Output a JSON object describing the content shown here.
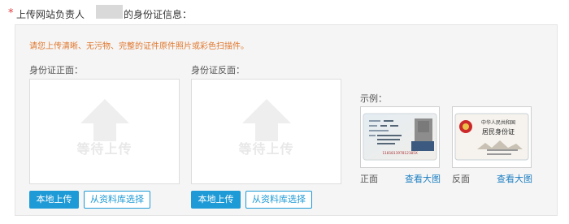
{
  "header": {
    "required_mark": "*",
    "label_prefix": "上传网站负责人",
    "label_suffix": "的身份证信息："
  },
  "notice": "请您上传清晰、无污物、完整的证件原件照片或彩色扫描件。",
  "upload_slots": [
    {
      "label": "身份证正面：",
      "placeholder": "等待上传",
      "local_upload_label": "本地上传",
      "library_select_label": "从资料库选择"
    },
    {
      "label": "身份证反面：",
      "placeholder": "等待上传",
      "local_upload_label": "本地上传",
      "library_select_label": "从资料库选择"
    }
  ],
  "example": {
    "label": "示例：",
    "front": {
      "caption": "正面",
      "view_link": "查看大图",
      "card_number": "110101197812105X"
    },
    "back": {
      "caption": "反面",
      "view_link": "查看大图",
      "card_title": "中华人民共和国",
      "card_subtitle": "居民身份证"
    }
  },
  "colors": {
    "required": "#e4393c",
    "notice": "#e0782e",
    "primary": "#1e9ad6",
    "link": "#1e7fc2",
    "panel_bg": "#f5f5f5"
  }
}
